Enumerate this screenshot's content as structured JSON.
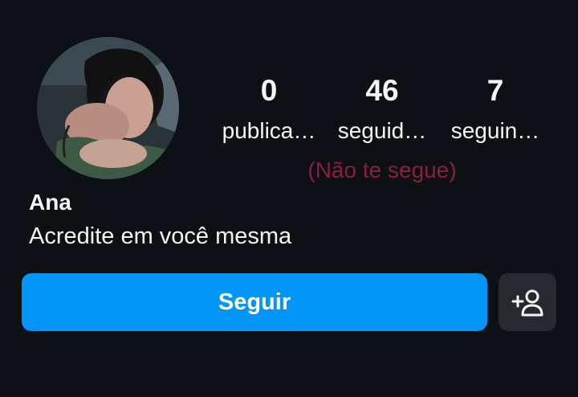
{
  "profile": {
    "name": "Ana",
    "bio": "Acredite em você mesma"
  },
  "stats": {
    "posts": {
      "value": "0",
      "label": "publica…"
    },
    "followers": {
      "value": "46",
      "label": "seguid…"
    },
    "following": {
      "value": "7",
      "label": "seguin…"
    }
  },
  "relationship": {
    "status_text": "(Não te segue)"
  },
  "actions": {
    "follow_label": "Seguir",
    "suggest_icon": "add-person-icon"
  },
  "colors": {
    "background": "#0d1014",
    "accent": "#0095f6",
    "status_text": "#8c1f3d",
    "secondary_button": "#262a30"
  }
}
